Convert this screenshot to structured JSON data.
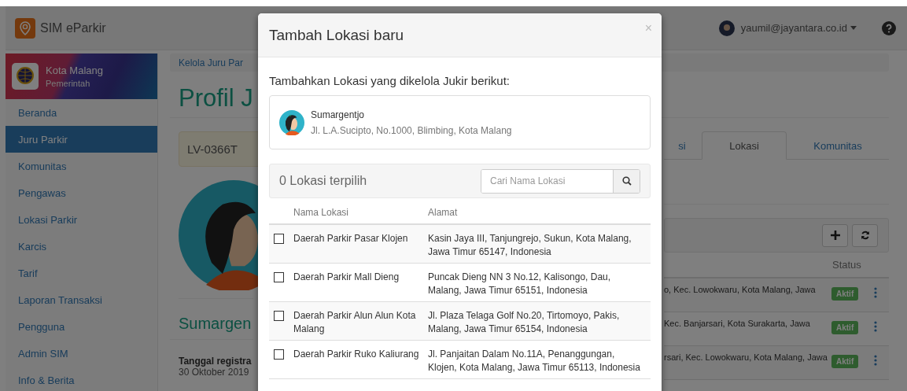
{
  "navbar": {
    "brand": "SIM eParkir",
    "user": "yaumil@jayantara.co.id"
  },
  "sidebar": {
    "org_name": "Kota Malang",
    "org_type": "Pemerintah",
    "items": [
      {
        "label": "Beranda",
        "selected": false
      },
      {
        "label": "Juru Parkir",
        "selected": true
      },
      {
        "label": "Komunitas",
        "selected": false
      },
      {
        "label": "Pengawas",
        "selected": false
      },
      {
        "label": "Lokasi Parkir",
        "selected": false
      },
      {
        "label": "Karcis",
        "selected": false
      },
      {
        "label": "Tarif",
        "selected": false
      },
      {
        "label": "Laporan Transaksi",
        "selected": false
      },
      {
        "label": "Pengguna",
        "selected": false
      },
      {
        "label": "Admin SIM",
        "selected": false
      },
      {
        "label": "Info & Berita",
        "selected": false
      }
    ]
  },
  "breadcrumb": "Kelola Juru Par",
  "page_title": "Profil J",
  "profile": {
    "code": "LV-0366T",
    "name": "Sumargen",
    "reg_label": "Tanggal registra",
    "reg_date": "30 Oktober 2019"
  },
  "tabs": [
    {
      "label": "si",
      "selected": false
    },
    {
      "label": "Lokasi",
      "selected": true
    },
    {
      "label": "Komunitas",
      "selected": false
    }
  ],
  "locations_table": {
    "columns": [
      "Status"
    ],
    "rows": [
      {
        "address": "o, Kec. Lowokwaru, Kota Malang, Jawa",
        "status": "Aktif"
      },
      {
        "address": "Kec. Banjarsari, Kota Surakarta, Jawa",
        "status": "Aktif"
      },
      {
        "address": "rsari, Kec. Lowokwaru, Kota Malang, Jawa",
        "status": "Aktif"
      }
    ]
  },
  "modal": {
    "title": "Tambah Lokasi baru",
    "close": "×",
    "intro": "Tambahkan Lokasi yang dikelola Jukir berikut:",
    "jukir": {
      "name": "Sumargentjo",
      "address": "Jl. L.A.Sucipto, No.1000, Blimbing, Kota Malang"
    },
    "selected_count": "0 Lokasi terpilih",
    "search": {
      "placeholder": "Cari Nama Lokasi"
    },
    "columns": [
      "Nama Lokasi",
      "Alamat"
    ],
    "rows": [
      {
        "name": "Daerah Parkir Pasar Klojen",
        "address": "Kasin Jaya III, Tanjungrejo, Sukun, Kota Malang, Jawa Timur 65147, Indonesia",
        "checked": false
      },
      {
        "name": "Daerah Parkir Mall Dieng",
        "address": "Puncak Dieng NN 3 No.12, Kalisongo, Dau, Malang, Jawa Timur 65151, Indonesia",
        "checked": false
      },
      {
        "name": "Daerah Parkir Alun Alun Kota Malang",
        "address": "Jl. Plaza Telaga Golf No.20, Tirtomoyo, Pakis, Malang, Jawa Timur 65154, Indonesia",
        "checked": false
      },
      {
        "name": "Daerah Parkir Ruko Kaliurang",
        "address": "Jl. Panjaitan Dalam No.11A, Penanggungan, Klojen, Kota Malang, Jawa Timur 65113, Indonesia",
        "checked": false
      }
    ]
  }
}
